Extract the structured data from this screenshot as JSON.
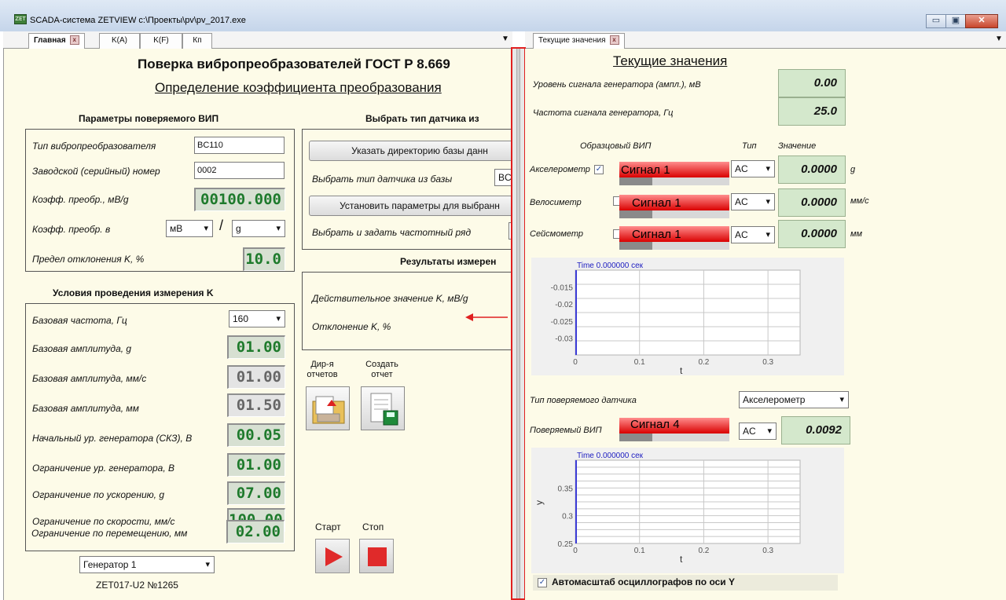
{
  "window": {
    "title": "SCADA-система ZETVIEW c:\\Проекты\\pv\\pv_2017.exe",
    "icon_text": "ZET",
    "controls": [
      "minimize-icon",
      "maximize-icon",
      "close-icon"
    ],
    "minimize": "▭",
    "maximize": "▣",
    "close": "✕"
  },
  "left_tabs": [
    {
      "label": "Главная",
      "active": true,
      "closable": true
    },
    {
      "label": "K(A)"
    },
    {
      "label": "K(F)"
    },
    {
      "label": "Кп"
    }
  ],
  "right_tabs": [
    {
      "label": "Текущие значения",
      "closable": true
    }
  ],
  "left": {
    "title": "Поверка вибропреобразователей ГОСТ Р 8.669",
    "subtitle": "Определение коэффициента преобразования",
    "params": {
      "header": "Параметры поверяемого ВИП",
      "sensor_type_label": "Тип вибропреобразователя",
      "sensor_type_value": "BC110",
      "serial_label": "Заводской (серийный) номер",
      "serial_value": "0002",
      "coef_label": "Коэфф. преобр., мВ/g",
      "coef_value": "00100.000",
      "coef_in_label": "Коэфф. преобр. в",
      "unit1": "мВ",
      "slash": "/",
      "unit2": "g",
      "limit_label": "Предел отклонения K, %",
      "limit_value": "10.0"
    },
    "conditions": {
      "header": "Условия проведения измерения K",
      "rows": [
        {
          "label": "Базовая частота, Гц",
          "value": "160",
          "kind": "combo"
        },
        {
          "label": "Базовая амплитуда, g",
          "value": "01.00",
          "kind": "lcd"
        },
        {
          "label": "Базовая амплитуда, мм/с",
          "value": "01.00",
          "kind": "grey"
        },
        {
          "label": "Базовая амплитуда, мм",
          "value": "01.50",
          "kind": "grey"
        },
        {
          "label": "Начальный ур. генератора (СКЗ), В",
          "value": "00.05",
          "kind": "lcd"
        },
        {
          "label": "Ограничение ур. генератора, В",
          "value": "01.00",
          "kind": "lcd"
        },
        {
          "label": "Ограничение по ускорению, g",
          "value": "07.00",
          "kind": "lcd"
        },
        {
          "label": "Ограничение по скорости, мм/с",
          "value": "100.00",
          "kind": "lcd"
        },
        {
          "label": "Ограничение по перемещению, мм",
          "value": "02.00",
          "kind": "lcd"
        }
      ]
    },
    "generator_select": "Генератор 1",
    "device_label": "ZET017-U2 №1265",
    "choose": {
      "header": "Выбрать тип датчика из",
      "dir_button": "Указать директорию базы данн",
      "choose_label": "Выбрать тип датчика из базы",
      "choose_value": "BC",
      "set_button": "Установить параметры для выбранн",
      "freq_label": "Выбрать и задать частотный ряд"
    },
    "results": {
      "header": "Результаты измерен",
      "actual_label": "Действительное значение K, мВ/g",
      "dev_label": "Отклонение K, %"
    },
    "reports": {
      "dir_label": "Дир-я отчетов",
      "create_label": "Создать отчет"
    },
    "run": {
      "start_label": "Старт",
      "stop_label": "Стоп"
    }
  },
  "right": {
    "title": "Текущие значения",
    "gen_level_label": "Уровень сигнала генератора (ампл.), мВ",
    "gen_level_value": "0.00",
    "gen_freq_label": "Частота сигнала генератора, Гц",
    "gen_freq_value": "25.0",
    "ref_header": "Образцовый ВИП",
    "type_header": "Тип",
    "value_header": "Значение",
    "sensors": [
      {
        "label": "Акселерометр",
        "checked": true,
        "signal": "Сигнал 1",
        "type": "AC",
        "value": "0.0000",
        "unit": "g"
      },
      {
        "label": "Велосиметр",
        "checked": false,
        "signal": "Сигнал 1",
        "type": "AC",
        "value": "0.0000",
        "unit": "мм/с"
      },
      {
        "label": "Сейсмометр",
        "checked": false,
        "signal": "Сигнал 1",
        "type": "AC",
        "value": "0.0000",
        "unit": "мм"
      }
    ],
    "dut_type_label": "Тип поверяемого датчика",
    "dut_type_value": "Акселерометр",
    "dut_label": "Поверяемый ВИП",
    "dut_signal": "Сигнал 4",
    "dut_type": "AC",
    "dut_value": "0.0092",
    "autoscale_label": "Автомасштаб осциллографов по оси Y",
    "autoscale_checked": true
  },
  "chart_data": [
    {
      "type": "line",
      "title": "Time 0.000000 сек",
      "xlabel": "t",
      "ylabel": "",
      "xlim": [
        0,
        0.35
      ],
      "ylim": [
        -0.035,
        -0.01
      ],
      "x_ticks": [
        "0",
        "0.1",
        "0.2",
        "0.3"
      ],
      "y_ticks": [
        "-0.015",
        "-0.02",
        "-0.025",
        "-0.03"
      ],
      "series": []
    },
    {
      "type": "line",
      "title": "Time 0.000000 сек",
      "xlabel": "t",
      "ylabel": "y",
      "xlim": [
        0,
        0.35
      ],
      "ylim": [
        0.25,
        0.4
      ],
      "x_ticks": [
        "0",
        "0.1",
        "0.2",
        "0.3"
      ],
      "y_ticks": [
        "0.35",
        "0.3",
        "0.25"
      ],
      "series": []
    }
  ],
  "colors": {
    "pane_bg": "#fdfbe8",
    "lcd_green": "#1e7a2c",
    "value_bg": "#d4e8cc",
    "signal_red": "#d90000",
    "splitter_highlight": "#e02020"
  }
}
